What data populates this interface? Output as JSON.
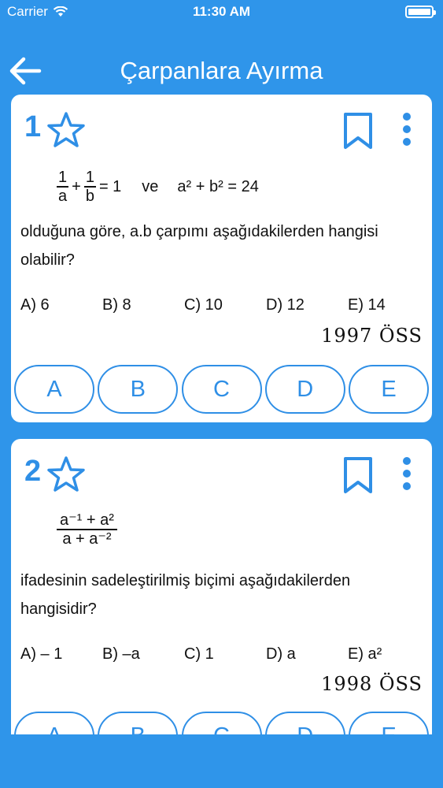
{
  "status_bar": {
    "carrier": "Carrier",
    "time": "11:30 AM"
  },
  "nav": {
    "title": "Çarpanlara Ayırma"
  },
  "questions": [
    {
      "number": "1",
      "formula": {
        "f1_num": "1",
        "f1_den": "a",
        "plus": "+",
        "f2_num": "1",
        "f2_den": "b",
        "eq": "= 1",
        "ve": "ve",
        "rhs": "a² + b² = 24"
      },
      "text": "olduğuna göre, a.b çarpımı aşağıdakilerden hangisi olabilir?",
      "choices": [
        "A) 6",
        "B) 8",
        "C) 10",
        "D) 12",
        "E) 14"
      ],
      "source": "1997 ÖSS",
      "answers": [
        "A",
        "B",
        "C",
        "D",
        "E"
      ]
    },
    {
      "number": "2",
      "formula": {
        "num": "a⁻¹ + a²",
        "den": "a + a⁻²"
      },
      "text": "ifadesinin sadeleştirilmiş biçimi aşağıdakilerden hangisidir?",
      "choices": [
        "A)  – 1",
        "B) –a",
        "C) 1",
        "D) a",
        "E) a²"
      ],
      "source": "1998 ÖSS",
      "answers": [
        "A",
        "B",
        "C",
        "D",
        "E"
      ]
    }
  ],
  "colors": {
    "background": "#2f95ea",
    "accent": "#2f8fe6",
    "card": "#ffffff"
  }
}
